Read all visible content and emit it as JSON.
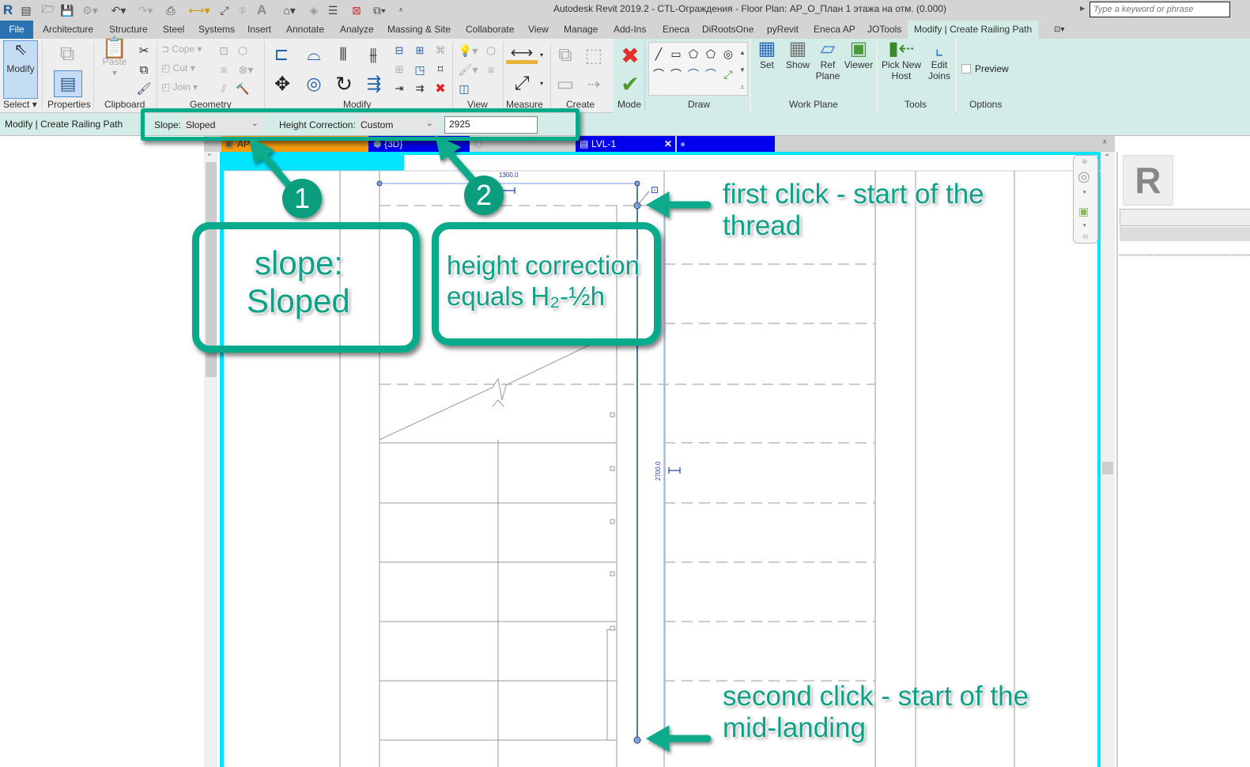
{
  "app": {
    "title": "Autodesk Revit 2019.2 - CTL-Ограждения - Floor Plan: АР_О_План 1 этажа на отм. (0.000)",
    "search_placeholder": "Type a keyword or phrase"
  },
  "quick_access": {
    "icons": [
      "revit-logo-icon",
      "recent-files-icon",
      "open-icon",
      "save-icon",
      "sync-icon",
      "undo-icon",
      "redo-icon",
      "print-icon",
      "measure-icon",
      "aligned-dimension-icon",
      "tag-icon",
      "text-icon",
      "default-3d-icon",
      "section-icon",
      "thin-lines-icon",
      "close-hidden-icon",
      "switch-windows-icon",
      "customize-icon"
    ]
  },
  "ribbon_tabs": [
    {
      "label": "File"
    },
    {
      "label": "Architecture"
    },
    {
      "label": "Structure"
    },
    {
      "label": "Steel"
    },
    {
      "label": "Systems"
    },
    {
      "label": "Insert"
    },
    {
      "label": "Annotate"
    },
    {
      "label": "Analyze"
    },
    {
      "label": "Massing & Site"
    },
    {
      "label": "Collaborate"
    },
    {
      "label": "View"
    },
    {
      "label": "Manage"
    },
    {
      "label": "Add-Ins"
    },
    {
      "label": "Eneca"
    },
    {
      "label": "DiRootsOne"
    },
    {
      "label": "pyRevit"
    },
    {
      "label": "Eneca AP"
    },
    {
      "label": "JOTools"
    },
    {
      "label": "Modify | Create Railing Path"
    }
  ],
  "ribbon": {
    "select": {
      "modify": "Modify",
      "label": "Select"
    },
    "properties": {
      "label": "Properties"
    },
    "clipboard": {
      "paste": "Paste",
      "label": "Clipboard"
    },
    "geometry": {
      "cope": "Cope",
      "cut": "Cut",
      "join": "Join",
      "label": "Geometry"
    },
    "modify": {
      "label": "Modify"
    },
    "view": {
      "label": "View"
    },
    "measure": {
      "label": "Measure"
    },
    "create": {
      "label": "Create"
    },
    "mode": {
      "label": "Mode"
    },
    "draw": {
      "label": "Draw"
    },
    "work_plane": {
      "set": "Set",
      "show": "Show",
      "ref_plane": "Ref Plane",
      "viewer": "Viewer",
      "label": "Work Plane"
    },
    "tools": {
      "pick_new_host": "Pick New Host",
      "edit_joins": "Edit Joins",
      "label": "Tools"
    },
    "options": {
      "preview": "Preview",
      "preview_checked": false,
      "label": "Options"
    }
  },
  "options_bar": {
    "context": "Modify | Create Railing Path",
    "slope_label": "Slope:",
    "slope_value": "Sloped",
    "height_correction_label": "Height Correction:",
    "height_correction_value": "Custom",
    "height_value": "2925"
  },
  "view_tabs": [
    {
      "label": "АР",
      "color": "#f39c12"
    },
    {
      "label": "{3D}",
      "color": "#0000ee"
    },
    {
      "label": "",
      "color": "#d0d0d0"
    },
    {
      "label": "LVL-1",
      "color": "#0000ee"
    },
    {
      "label": "",
      "color": "#0000ee"
    }
  ],
  "canvas": {
    "dim_horizontal": "1300.0",
    "dim_vertical": "2700.0"
  },
  "annotations": {
    "callout_1": "1",
    "callout_2": "2",
    "box1_line1": "slope:",
    "box1_line2": "Sloped",
    "box2_line1": "height correction",
    "box2_line2": "equals H₂-½h",
    "note_first_line1": "first click - start of the",
    "note_first_line2": "thread",
    "note_second_line1": "second click - start of the",
    "note_second_line2": "mid-landing",
    "accent_color": "#07ab8c"
  }
}
